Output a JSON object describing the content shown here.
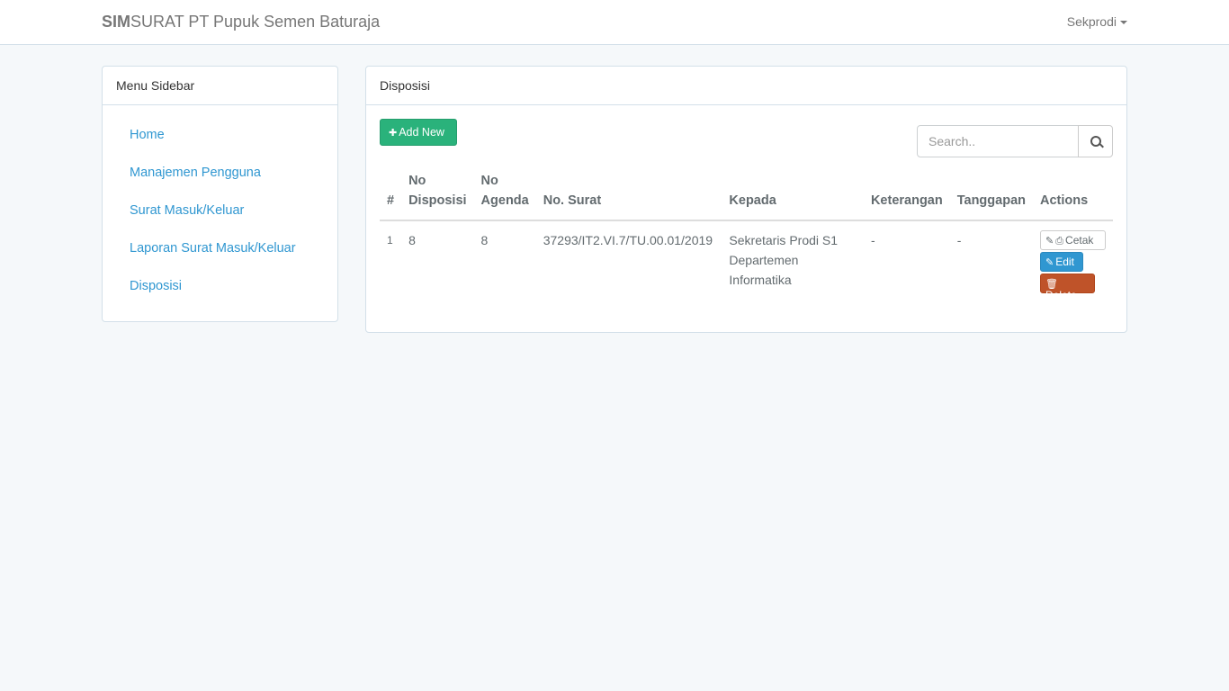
{
  "navbar": {
    "brand_bold": "SIM",
    "brand_rest": "SURAT PT Pupuk Semen Baturaja",
    "user": "Sekprodi"
  },
  "sidebar": {
    "title": "Menu Sidebar",
    "items": [
      {
        "label": "Home"
      },
      {
        "label": "Manajemen Pengguna"
      },
      {
        "label": "Surat Masuk/Keluar"
      },
      {
        "label": "Laporan Surat Masuk/Keluar"
      },
      {
        "label": "Disposisi"
      }
    ]
  },
  "main": {
    "title": "Disposisi",
    "add_button": "Add New",
    "search_placeholder": "Search..",
    "table": {
      "headers": {
        "num": "#",
        "no_disposisi_1": "No",
        "no_disposisi_2": "Disposisi",
        "no_agenda_1": "No",
        "no_agenda_2": "Agenda",
        "no_surat": "No. Surat",
        "kepada": "Kepada",
        "keterangan": "Keterangan",
        "tanggapan": "Tanggapan",
        "actions": "Actions"
      },
      "rows": [
        {
          "num": "1",
          "no_disposisi": "8",
          "no_agenda": "8",
          "no_surat": "37293/IT2.VI.7/TU.00.01/2019",
          "kepada_1": "Sekretaris Prodi S1",
          "kepada_2": "Departemen",
          "kepada_3": "Informatika",
          "keterangan": "-",
          "tanggapan": "-",
          "cetak": "Cetak",
          "edit": "Edit",
          "delete": "Delete"
        }
      ]
    }
  }
}
